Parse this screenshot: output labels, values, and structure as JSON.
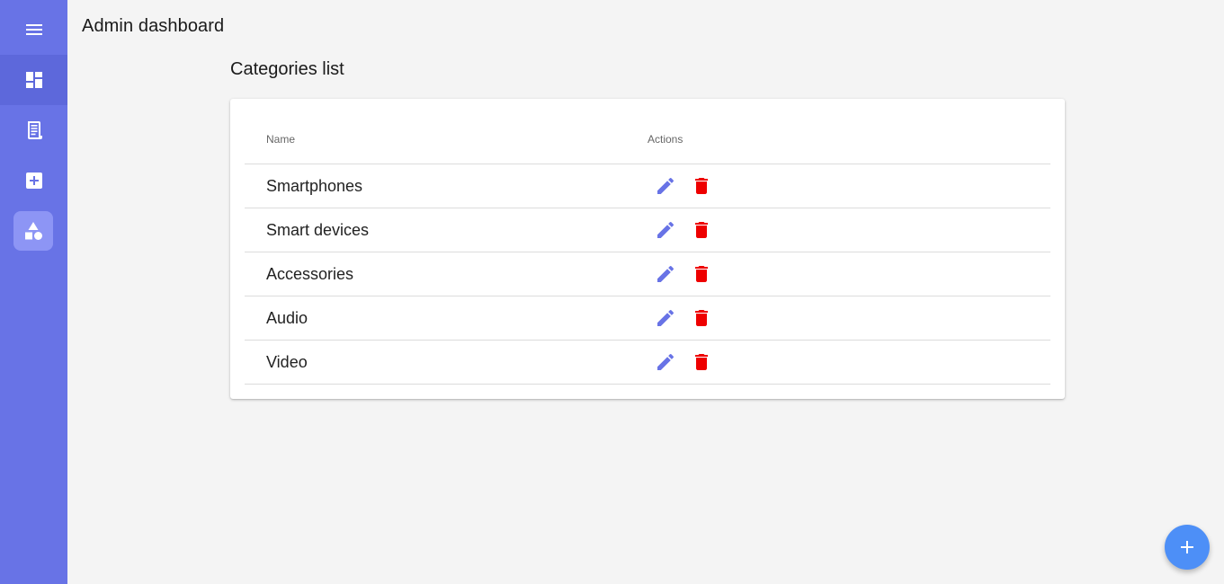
{
  "app": {
    "title": "Admin dashboard"
  },
  "sidebar": {
    "items": [
      {
        "icon": "menu-icon"
      },
      {
        "icon": "dashboard-icon"
      },
      {
        "icon": "receipt-icon"
      },
      {
        "icon": "add-box-icon"
      },
      {
        "icon": "category-icon",
        "active": true
      }
    ]
  },
  "section": {
    "title": "Categories list"
  },
  "table": {
    "headers": {
      "name": "Name",
      "actions": "Actions"
    },
    "rows": [
      {
        "name": "Smartphones"
      },
      {
        "name": "Smart devices"
      },
      {
        "name": "Accessories"
      },
      {
        "name": "Audio"
      },
      {
        "name": "Video"
      }
    ]
  },
  "fab": {
    "icon": "plus-icon"
  },
  "colors": {
    "sidebar": "#6873e6",
    "edit": "#6873e6",
    "delete": "#ee0000",
    "fab": "#4d8ff7",
    "background": "#f4f4f4"
  }
}
